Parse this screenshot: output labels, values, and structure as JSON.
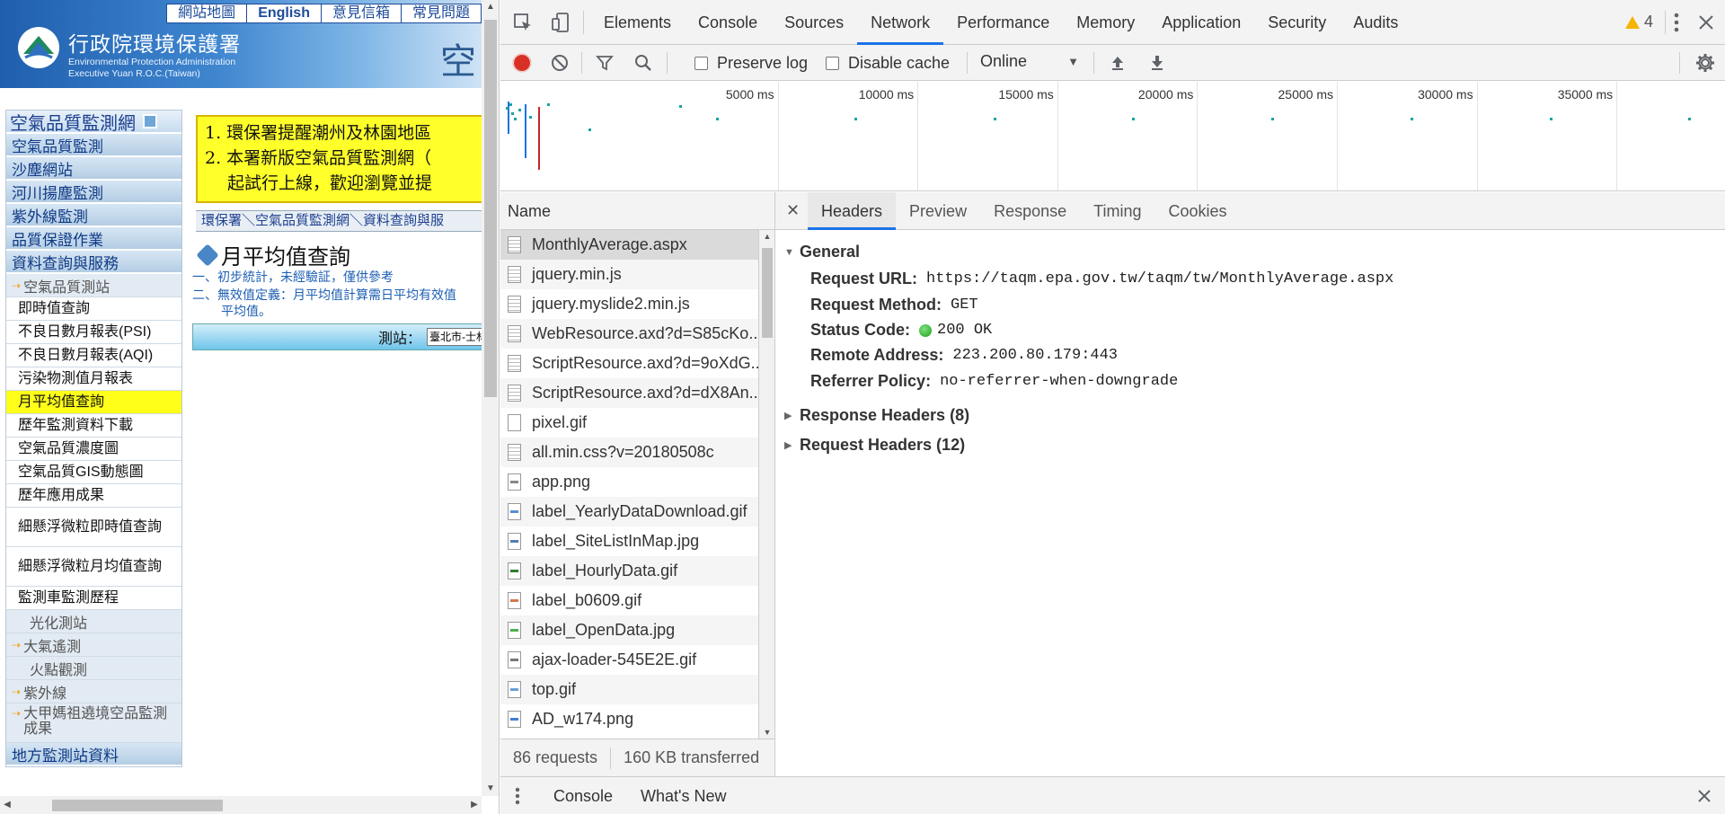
{
  "site": {
    "top_links": [
      "網站地圖",
      "English",
      "意見信箱",
      "常見問題"
    ],
    "agency_name": "行政院環境保護署",
    "agency_en_1": "Environmental Protection Administration",
    "agency_en_2": "Executive Yuan R.O.C.(Taiwan)",
    "banner_big_char": "空",
    "menu_title": "空氣品質監測網",
    "menu": [
      {
        "type": "cat",
        "label": "空氣品質監測"
      },
      {
        "type": "cat",
        "label": "沙塵網站"
      },
      {
        "type": "cat",
        "label": "河川揚塵監測"
      },
      {
        "type": "cat",
        "label": "紫外線監測"
      },
      {
        "type": "cat",
        "label": "品質保證作業"
      },
      {
        "type": "cat",
        "label": "資料查詢與服務"
      },
      {
        "type": "sub",
        "label": "空氣品質測站",
        "arrow": true
      },
      {
        "type": "item",
        "label": "即時值查詢"
      },
      {
        "type": "item",
        "label": "不良日數月報表(PSI)"
      },
      {
        "type": "item",
        "label": "不良日數月報表(AQI)"
      },
      {
        "type": "item",
        "label": "污染物測值月報表"
      },
      {
        "type": "item",
        "label": "月平均值查詢",
        "active": true
      },
      {
        "type": "item",
        "label": "歷年監測資料下載"
      },
      {
        "type": "item",
        "label": "空氣品質濃度圖"
      },
      {
        "type": "item",
        "label": "空氣品質GIS動態圖"
      },
      {
        "type": "item",
        "label": "歷年應用成果"
      },
      {
        "type": "item",
        "label": "細懸浮微粒即時值查詢",
        "wrap": true
      },
      {
        "type": "item",
        "label": "細懸浮微粒月均值查詢",
        "wrap": true
      },
      {
        "type": "item",
        "label": "監測車監測歷程"
      },
      {
        "type": "sub",
        "label": "光化測站",
        "indent": true
      },
      {
        "type": "sub",
        "label": "大氣遙測",
        "arrow": true
      },
      {
        "type": "sub",
        "label": "火點觀測",
        "indent": true
      },
      {
        "type": "sub",
        "label": "紫外線",
        "arrow": true
      },
      {
        "type": "sub",
        "label": "大甲媽祖遶境空品監測成果",
        "arrow": true,
        "wrap": true
      },
      {
        "type": "cat",
        "label": "地方監測站資料"
      }
    ],
    "notice_line1": "1. 環保署提醒潮州及林園地區",
    "notice_line2": "2. 本署新版空氣品質監測網（",
    "notice_line3": "　 起試行上線，歡迎瀏覽並提",
    "breadcrumb": "環保署＼空氣品質監測網＼資料查詢與服",
    "page_title": "月平均值查詢",
    "note1": "一、初步統計，未經驗証，僅供參考",
    "note2": "二、無效值定義：月平均值計算需日平均有效值",
    "note2b": "平均值。",
    "station_label": "測站：",
    "station_value": "臺北市-士林"
  },
  "devtools": {
    "tabs": [
      "Elements",
      "Console",
      "Sources",
      "Network",
      "Performance",
      "Memory",
      "Application",
      "Security",
      "Audits"
    ],
    "selected_tab": "Network",
    "warning_count": "4",
    "preserve_log": "Preserve log",
    "disable_cache": "Disable cache",
    "throttle": "Online",
    "timeline_labels": [
      "5000 ms",
      "10000 ms",
      "15000 ms",
      "20000 ms",
      "25000 ms",
      "30000 ms",
      "35000 ms"
    ],
    "name_header": "Name",
    "requests": [
      {
        "name": "MonthlyAverage.aspx",
        "icon": "doc",
        "selected": true
      },
      {
        "name": "jquery.min.js",
        "icon": "doc"
      },
      {
        "name": "jquery.myslide2.min.js",
        "icon": "doc"
      },
      {
        "name": "WebResource.axd?d=S85cKo...",
        "icon": "doc"
      },
      {
        "name": "ScriptResource.axd?d=9oXdG...",
        "icon": "doc"
      },
      {
        "name": "ScriptResource.axd?d=dX8An...",
        "icon": "doc"
      },
      {
        "name": "pixel.gif",
        "icon": "blank"
      },
      {
        "name": "all.min.css?v=20180508c",
        "icon": "doc"
      },
      {
        "name": "app.png",
        "icon": "img",
        "color": "#888888"
      },
      {
        "name": "label_YearlyDataDownload.gif",
        "icon": "img",
        "color": "#5a8fd0"
      },
      {
        "name": "label_SiteListInMap.jpg",
        "icon": "img",
        "color": "#4f7fb0"
      },
      {
        "name": "label_HourlyData.gif",
        "icon": "img",
        "color": "#2e7d32"
      },
      {
        "name": "label_b0609.gif",
        "icon": "img",
        "color": "#d07a4a"
      },
      {
        "name": "label_OpenData.jpg",
        "icon": "img",
        "color": "#4caf50"
      },
      {
        "name": "ajax-loader-545E2E.gif",
        "icon": "img",
        "color": "#777777"
      },
      {
        "name": "top.gif",
        "icon": "img",
        "color": "#6a9fd8"
      },
      {
        "name": "AD_w174.png",
        "icon": "img",
        "color": "#3f7fd0"
      }
    ],
    "summary_requests": "86 requests",
    "summary_transferred": "160 KB transferred",
    "detail_tabs": [
      "Headers",
      "Preview",
      "Response",
      "Timing",
      "Cookies"
    ],
    "selected_detail_tab": "Headers",
    "general_title": "General",
    "general": {
      "request_url_key": "Request URL:",
      "request_url": "https://taqm.epa.gov.tw/taqm/tw/MonthlyAverage.aspx",
      "request_method_key": "Request Method:",
      "request_method": "GET",
      "status_code_key": "Status Code:",
      "status_code": "200 OK",
      "remote_address_key": "Remote Address:",
      "remote_address": "223.200.80.179:443",
      "referrer_policy_key": "Referrer Policy:",
      "referrer_policy": "no-referrer-when-downgrade"
    },
    "response_headers": "Response Headers (8)",
    "request_headers": "Request Headers (12)",
    "drawer_console": "Console",
    "drawer_whats_new": "What's New"
  }
}
